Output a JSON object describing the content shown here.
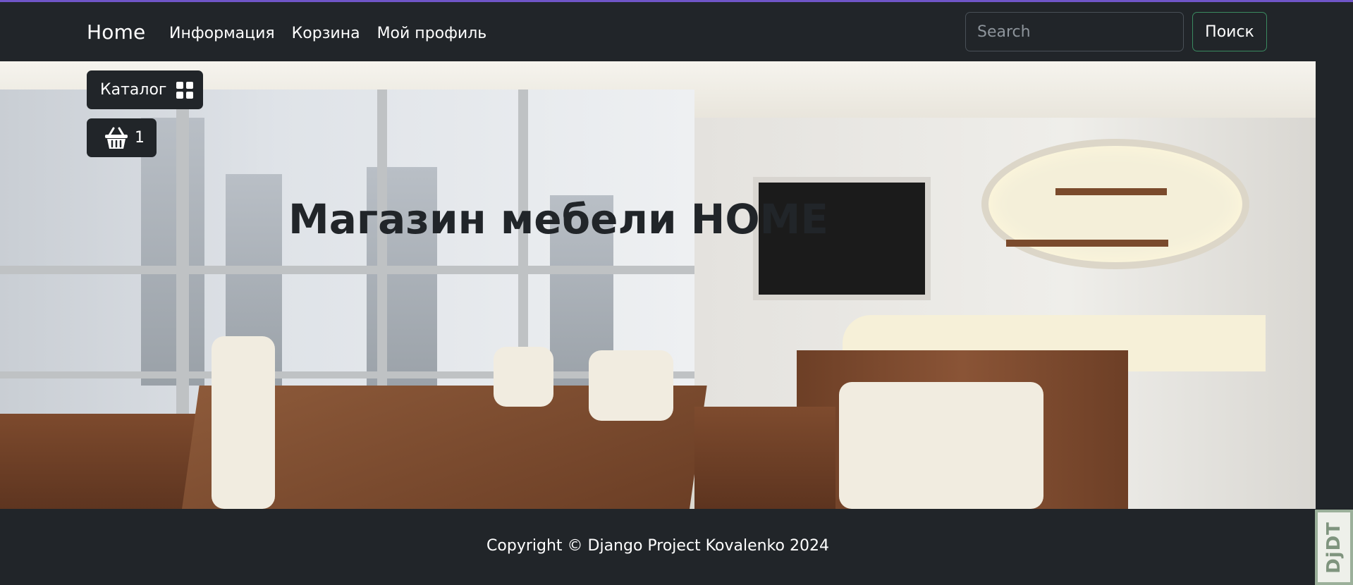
{
  "navbar": {
    "brand": "Home",
    "links": [
      "Информация",
      "Корзина",
      "Мой профиль"
    ],
    "search": {
      "placeholder": "Search",
      "value": ""
    },
    "search_button": "Поиск"
  },
  "hero": {
    "title": "Магазин мебели HOME",
    "catalog_button": "Каталог",
    "cart_count": "1"
  },
  "footer": {
    "copyright": "Copyright © Django Project Kovalenko 2024"
  },
  "debug_toolbar": {
    "label": "DjDT"
  },
  "icons": [
    "grid-icon",
    "basket-icon"
  ],
  "colors": {
    "navbar_bg": "#212529",
    "accent_line": "#6f55c7",
    "search_button_border": "#3a8a60"
  }
}
